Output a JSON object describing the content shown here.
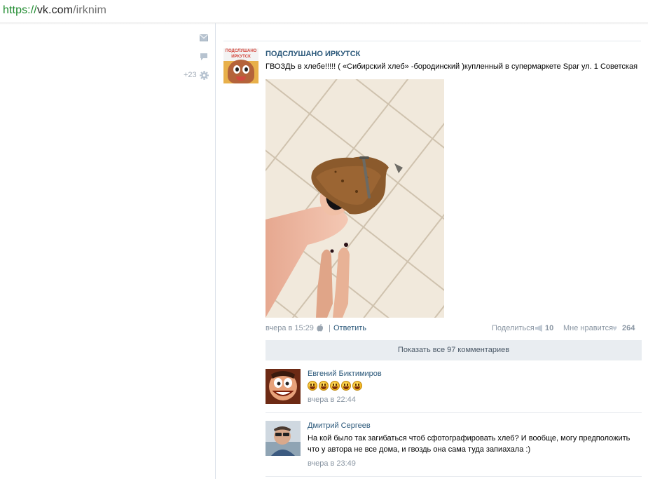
{
  "address_bar": {
    "scheme": "https://",
    "host": "vk.com",
    "path": "/irknim"
  },
  "sidebar": {
    "icons": [
      "envelope-icon",
      "chat-bubble-icon",
      "gear-icon"
    ],
    "counter": "+23"
  },
  "post": {
    "author": "ПОДСЛУШАНО ИРКУТСК",
    "avatar_caption": "ПОДСЛУШАНО ИРКУТСК",
    "text": "ГВОЗДЬ в хлебе!!!!! ( «Сибирский хлеб» -бородинский )купленный в супермаркете Spar ул. 1 Советская",
    "time": "вчера в 15:29",
    "reply_label": "Ответить",
    "share_label": "Поделиться",
    "share_count": "10",
    "like_label": "Мне нравится",
    "like_count": "264"
  },
  "show_all_comments": "Показать все 97 комментариев",
  "comments": [
    {
      "author": "Евгений Биктимиров",
      "emoji_count": 5,
      "time": "вчера в 22:44"
    },
    {
      "author": "Дмитрий Сергеев",
      "text": "На кой было так загибаться чтоб сфотографировать хлеб? И вообще, могу предположить что у автора не все дома, и гвоздь она сама туда запиахала :)",
      "time": "вчера в 23:49"
    }
  ],
  "colors": {
    "link": "#2b587a",
    "muted": "#8a96a3",
    "button_bg": "#e9edf1",
    "scheme_green": "#1e8a2e"
  }
}
